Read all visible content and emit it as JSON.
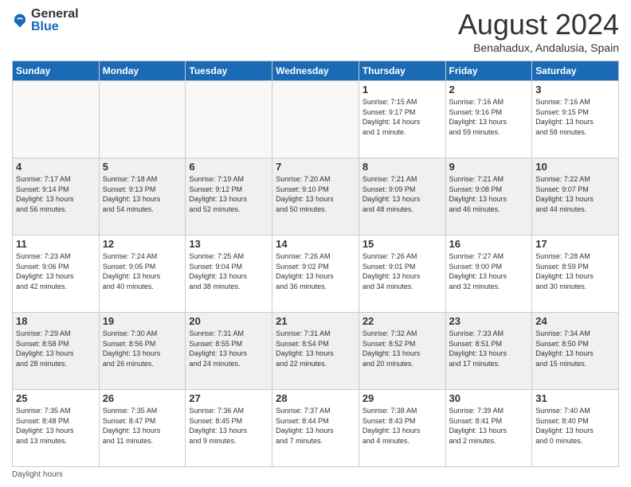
{
  "header": {
    "logo_general": "General",
    "logo_blue": "Blue",
    "month_title": "August 2024",
    "location": "Benahadux, Andalusia, Spain"
  },
  "days_of_week": [
    "Sunday",
    "Monday",
    "Tuesday",
    "Wednesday",
    "Thursday",
    "Friday",
    "Saturday"
  ],
  "weeks": [
    [
      {
        "day": "",
        "info": ""
      },
      {
        "day": "",
        "info": ""
      },
      {
        "day": "",
        "info": ""
      },
      {
        "day": "",
        "info": ""
      },
      {
        "day": "1",
        "info": "Sunrise: 7:15 AM\nSunset: 9:17 PM\nDaylight: 14 hours\nand 1 minute."
      },
      {
        "day": "2",
        "info": "Sunrise: 7:16 AM\nSunset: 9:16 PM\nDaylight: 13 hours\nand 59 minutes."
      },
      {
        "day": "3",
        "info": "Sunrise: 7:16 AM\nSunset: 9:15 PM\nDaylight: 13 hours\nand 58 minutes."
      }
    ],
    [
      {
        "day": "4",
        "info": "Sunrise: 7:17 AM\nSunset: 9:14 PM\nDaylight: 13 hours\nand 56 minutes."
      },
      {
        "day": "5",
        "info": "Sunrise: 7:18 AM\nSunset: 9:13 PM\nDaylight: 13 hours\nand 54 minutes."
      },
      {
        "day": "6",
        "info": "Sunrise: 7:19 AM\nSunset: 9:12 PM\nDaylight: 13 hours\nand 52 minutes."
      },
      {
        "day": "7",
        "info": "Sunrise: 7:20 AM\nSunset: 9:10 PM\nDaylight: 13 hours\nand 50 minutes."
      },
      {
        "day": "8",
        "info": "Sunrise: 7:21 AM\nSunset: 9:09 PM\nDaylight: 13 hours\nand 48 minutes."
      },
      {
        "day": "9",
        "info": "Sunrise: 7:21 AM\nSunset: 9:08 PM\nDaylight: 13 hours\nand 46 minutes."
      },
      {
        "day": "10",
        "info": "Sunrise: 7:22 AM\nSunset: 9:07 PM\nDaylight: 13 hours\nand 44 minutes."
      }
    ],
    [
      {
        "day": "11",
        "info": "Sunrise: 7:23 AM\nSunset: 9:06 PM\nDaylight: 13 hours\nand 42 minutes."
      },
      {
        "day": "12",
        "info": "Sunrise: 7:24 AM\nSunset: 9:05 PM\nDaylight: 13 hours\nand 40 minutes."
      },
      {
        "day": "13",
        "info": "Sunrise: 7:25 AM\nSunset: 9:04 PM\nDaylight: 13 hours\nand 38 minutes."
      },
      {
        "day": "14",
        "info": "Sunrise: 7:26 AM\nSunset: 9:02 PM\nDaylight: 13 hours\nand 36 minutes."
      },
      {
        "day": "15",
        "info": "Sunrise: 7:26 AM\nSunset: 9:01 PM\nDaylight: 13 hours\nand 34 minutes."
      },
      {
        "day": "16",
        "info": "Sunrise: 7:27 AM\nSunset: 9:00 PM\nDaylight: 13 hours\nand 32 minutes."
      },
      {
        "day": "17",
        "info": "Sunrise: 7:28 AM\nSunset: 8:59 PM\nDaylight: 13 hours\nand 30 minutes."
      }
    ],
    [
      {
        "day": "18",
        "info": "Sunrise: 7:29 AM\nSunset: 8:58 PM\nDaylight: 13 hours\nand 28 minutes."
      },
      {
        "day": "19",
        "info": "Sunrise: 7:30 AM\nSunset: 8:56 PM\nDaylight: 13 hours\nand 26 minutes."
      },
      {
        "day": "20",
        "info": "Sunrise: 7:31 AM\nSunset: 8:55 PM\nDaylight: 13 hours\nand 24 minutes."
      },
      {
        "day": "21",
        "info": "Sunrise: 7:31 AM\nSunset: 8:54 PM\nDaylight: 13 hours\nand 22 minutes."
      },
      {
        "day": "22",
        "info": "Sunrise: 7:32 AM\nSunset: 8:52 PM\nDaylight: 13 hours\nand 20 minutes."
      },
      {
        "day": "23",
        "info": "Sunrise: 7:33 AM\nSunset: 8:51 PM\nDaylight: 13 hours\nand 17 minutes."
      },
      {
        "day": "24",
        "info": "Sunrise: 7:34 AM\nSunset: 8:50 PM\nDaylight: 13 hours\nand 15 minutes."
      }
    ],
    [
      {
        "day": "25",
        "info": "Sunrise: 7:35 AM\nSunset: 8:48 PM\nDaylight: 13 hours\nand 13 minutes."
      },
      {
        "day": "26",
        "info": "Sunrise: 7:35 AM\nSunset: 8:47 PM\nDaylight: 13 hours\nand 11 minutes."
      },
      {
        "day": "27",
        "info": "Sunrise: 7:36 AM\nSunset: 8:45 PM\nDaylight: 13 hours\nand 9 minutes."
      },
      {
        "day": "28",
        "info": "Sunrise: 7:37 AM\nSunset: 8:44 PM\nDaylight: 13 hours\nand 7 minutes."
      },
      {
        "day": "29",
        "info": "Sunrise: 7:38 AM\nSunset: 8:43 PM\nDaylight: 13 hours\nand 4 minutes."
      },
      {
        "day": "30",
        "info": "Sunrise: 7:39 AM\nSunset: 8:41 PM\nDaylight: 13 hours\nand 2 minutes."
      },
      {
        "day": "31",
        "info": "Sunrise: 7:40 AM\nSunset: 8:40 PM\nDaylight: 13 hours\nand 0 minutes."
      }
    ]
  ],
  "footer": {
    "note": "Daylight hours"
  }
}
